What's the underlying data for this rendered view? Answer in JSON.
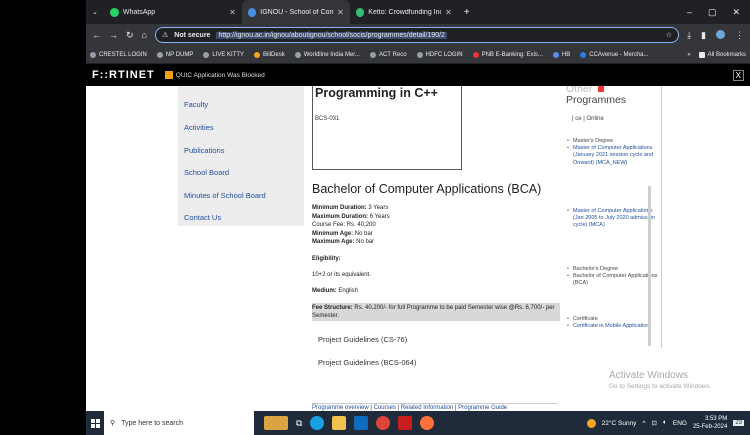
{
  "tabs": [
    {
      "title": "WhatsApp",
      "favicon_color": "#25d366",
      "active": false
    },
    {
      "title": "IGNOU - School of Computer and",
      "favicon_color": "#4a90e2",
      "active": true
    },
    {
      "title": "Ketto: Crowdfunding India | Onl",
      "favicon_color": "#2fbf71",
      "active": false
    }
  ],
  "new_tab": "+",
  "window_controls": [
    "–",
    "▢",
    "✕"
  ],
  "address": {
    "security": "Not secure",
    "url": "http://ignou.ac.in/ignou/aboutignou/school/socis/programmes/detail/190/2"
  },
  "bookmarks": [
    "CRESTEL LOGIN",
    "NP DUMP",
    "LIVE KITTY",
    "BillDesk",
    "Worldline India Mer...",
    "ACT Reco",
    "HDFC LOGIN",
    "PNB E-Banking: Exis...",
    "HB",
    "CCAvenue - Mercha..."
  ],
  "bookmarks_more": "»",
  "all_bookmarks": "All Bookmarks",
  "fortinet": {
    "logo": "F::RTINET",
    "message": "QUIC Application Was Blocked",
    "close": "X"
  },
  "left_nav": [
    "Faculty",
    "Activities",
    "Publications",
    "School Board",
    "Minutes of School Board",
    "Contact Us"
  ],
  "cpp_box": {
    "title": "Programming in C++",
    "code": "BCS-031"
  },
  "bca": {
    "title": "Bachelor of Computer Applications (BCA)",
    "min_duration_label": "Minimum Duration:",
    "min_duration": "3 Years",
    "max_duration_label": "Maximum Duration:",
    "max_duration": "6 Years",
    "course_fee_label": "Course Fee:",
    "course_fee": "Rs. 40,200",
    "min_age_label": "Minimum Age:",
    "min_age": "No bar",
    "max_age_label": "Maximum Age:",
    "max_age": "No bar",
    "eligibility_label": "Eligibility:",
    "eligibility": "10+2 or its equivalent.",
    "medium_label": "Medium:",
    "medium": "English",
    "fee_label": "Fee Structure:",
    "fee_text": "Rs. 40,200/- for full Programme to be paid Semester wise @Rs. 6,700/- per Semester.",
    "guideline_1": "Project Guidelines (CS-76)",
    "guideline_2": "Project Guidelines (BCS-064)"
  },
  "footer": {
    "overview": "Programme overview",
    "sep": "|",
    "courses": "Courses",
    "related": "Related Information",
    "guide": "Programme Guide"
  },
  "right_col": {
    "heading_1": "Other",
    "heading_2": "Programmes",
    "tabs_line": "|      ce  | Online",
    "groups": [
      {
        "head": "Master's Degree",
        "sub": [
          "Master of Computer Applications (January 2021 session cycle and Onward) (MCA_NEW)"
        ]
      },
      {
        "head": "Master of Computer Applications (Jan 2005 to July 2020 admission cycle) (MCA)",
        "sub": []
      },
      {
        "head": "Bachelor's Degree",
        "sub": [],
        "plain": [
          "Bachelor of Computer Applications (BCA)"
        ]
      },
      {
        "head": "Certificate",
        "sub": [
          "Certificate in Mobile Application"
        ]
      }
    ]
  },
  "activate": {
    "line1": "Activate Windows",
    "line2": "Go to Settings to activate Windows."
  },
  "taskbar": {
    "search_placeholder": "Type here to search",
    "weather": "22°C  Sunny",
    "lang": "ENG",
    "time": "3:53 PM",
    "date": "25-Feb-2024",
    "notif_count": "23"
  }
}
